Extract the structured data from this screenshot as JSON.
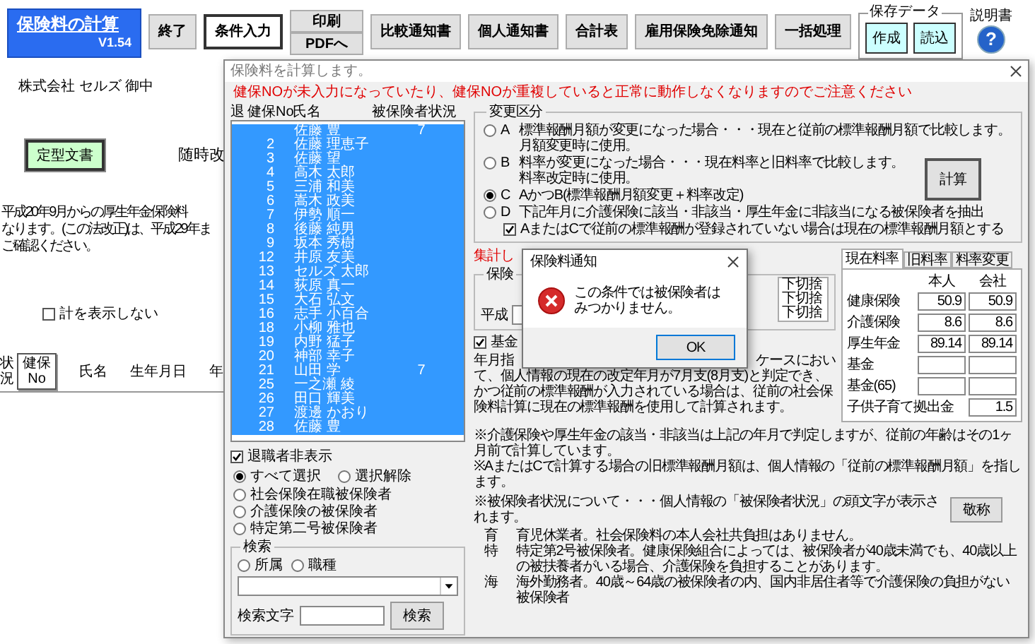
{
  "app_title": {
    "name": "保険料の計算",
    "version": "V1.54"
  },
  "toolbar": [
    {
      "kind": "button",
      "label": "終了",
      "selected": false
    },
    {
      "kind": "button",
      "label": "条件入力",
      "selected": true
    },
    {
      "kind": "stack",
      "labels": [
        "印刷",
        "PDFへ"
      ],
      "selected": false
    },
    {
      "kind": "button",
      "label": "比較通知書",
      "selected": false
    },
    {
      "kind": "button",
      "label": "個人通知書",
      "selected": false
    },
    {
      "kind": "button",
      "label": "合計表",
      "selected": false
    },
    {
      "kind": "button",
      "label": "雇用保険免除通知",
      "selected": false
    },
    {
      "kind": "button",
      "label": "一括処理",
      "selected": false
    }
  ],
  "save_data": {
    "title": "保存データ",
    "buttons": [
      "作成",
      "読込"
    ]
  },
  "help": {
    "label": "説明書",
    "icon": "?"
  },
  "sheet": {
    "company": "株式会社 セルズ 御中",
    "template_button": "定型文書",
    "heading": "随時改",
    "notice": [
      "平成20年9月からの厚生年金保険料",
      "なります。(この法改正)は、平成29年ま",
      "ご確認ください。"
    ],
    "hide_total": {
      "label": "計を表示しない",
      "checked": false
    },
    "columns": [
      {
        "kind": "vertical",
        "label": "状況"
      },
      {
        "kind": "button",
        "label": "健保No"
      },
      {
        "kind": "text",
        "label": "氏名"
      },
      {
        "kind": "text",
        "label": "生年月日"
      },
      {
        "kind": "text",
        "label": "年"
      }
    ]
  },
  "dialog": {
    "title": "保険料を計算します。",
    "warning": "健保NOが未入力になっていたり、健保NOが重複していると正常に動作しなくなりますのでご注意ください",
    "list_headers": [
      "退",
      "健保No",
      "氏名",
      "被保険者状況"
    ],
    "rows": [
      {
        "name": "佐藤 豊",
        "status": "7",
        "selected": true
      },
      {
        "no": "2",
        "name": "佐藤 理恵子",
        "selected": true
      },
      {
        "no": "3",
        "name": "佐藤 望",
        "selected": true
      },
      {
        "no": "4",
        "name": "高木 太郎",
        "selected": true
      },
      {
        "no": "5",
        "name": "三浦 和美",
        "selected": true
      },
      {
        "no": "6",
        "name": "嵩木 政美",
        "selected": true
      },
      {
        "no": "7",
        "name": "伊勢 順一",
        "selected": true
      },
      {
        "no": "8",
        "name": "後藤 純男",
        "selected": true
      },
      {
        "no": "9",
        "name": "坂本 秀樹",
        "selected": true
      },
      {
        "no": "12",
        "name": "井原 友美",
        "selected": true
      },
      {
        "no": "13",
        "name": "セルズ 太郎",
        "selected": true
      },
      {
        "no": "14",
        "name": "荻原 真一",
        "selected": true
      },
      {
        "no": "15",
        "name": "大石 弘文",
        "selected": true
      },
      {
        "no": "16",
        "name": "志手 小百合",
        "selected": true
      },
      {
        "no": "18",
        "name": "小柳 雅也",
        "selected": true
      },
      {
        "no": "19",
        "name": "内野 猛子",
        "selected": true
      },
      {
        "no": "20",
        "name": "神部 幸子",
        "selected": true
      },
      {
        "no": "21",
        "name": "山田 学",
        "status": "7",
        "selected": true
      },
      {
        "no": "25",
        "name": "一之瀬 綾",
        "selected": true
      },
      {
        "no": "26",
        "name": "田口 輝美",
        "selected": true
      },
      {
        "no": "27",
        "name": "渡邊 かおり",
        "selected": true
      },
      {
        "no": "28",
        "name": "佐藤 豊",
        "selected": true
      }
    ],
    "hide_retired": {
      "label": "退職者非表示",
      "checked": true
    },
    "select_all": [
      {
        "label": "すべて選択",
        "selected": true
      },
      {
        "label": "選択解除",
        "selected": false
      }
    ],
    "filters": [
      {
        "label": "社会保険在職被保険者",
        "selected": false
      },
      {
        "label": "介護保険の被保険者",
        "selected": false
      },
      {
        "label": "特定第二号被保険者",
        "selected": false
      }
    ],
    "search": {
      "title": "検索",
      "options": [
        {
          "label": "所属",
          "selected": false
        },
        {
          "label": "職種",
          "selected": false
        }
      ],
      "text_label": "検索文字",
      "button": "検索"
    },
    "change": {
      "title": "変更区分",
      "options": [
        {
          "letter": "A",
          "label": "標準報酬月額が変更になった場合・・・現在と従前の標準報酬月額で比較します。月額変更時に使用。",
          "selected": false
        },
        {
          "letter": "B",
          "label": "料率が変更になった場合・・・現在料率と旧料率で比較します。料率改定時に使用。",
          "selected": false
        },
        {
          "letter": "C",
          "label": "AかつB(標準報酬月額変更＋料率改定)",
          "selected": true
        },
        {
          "letter": "D",
          "label": "下記年月に介護保険に該当・非該当・厚生年金に非該当になる被保険者を抽出",
          "selected": false
        }
      ],
      "sub_check": {
        "label": "AまたはCで従前の標準報酬が登録されていない場合は現在の標準報酬月額とする",
        "checked": true
      },
      "calc_button": "計算"
    },
    "summary": {
      "red_label": "集計し",
      "group_title": "保険",
      "era": "平成",
      "rounding": [
        "下切捨",
        "下切捨",
        "下切捨"
      ],
      "fund": {
        "label": "基金",
        "checked": true
      },
      "para_start": "年月指",
      "para_end": "ケースにおい",
      "para": "て、個人情報の現在の改定年月が7月支(8月支)と判定でき、かつ従前の標準報酬が入力されている場合は、従前の社会保険料計算に現在の標準報酬を使用して計算されます。"
    },
    "rates": {
      "tabs": [
        {
          "label": "現在料率",
          "selected": true
        },
        {
          "label": "旧料率",
          "selected": false
        },
        {
          "label": "料率変更",
          "selected": false
        }
      ],
      "headers": [
        "本人",
        "会社"
      ],
      "rows": [
        {
          "label": "健康保険",
          "person": "50.9",
          "company": "50.9"
        },
        {
          "label": "介護保険",
          "person": "8.6",
          "company": "8.6"
        },
        {
          "label": "厚生年金",
          "person": "89.14",
          "company": "89.14"
        },
        {
          "label": "基金"
        },
        {
          "label": "基金(65)"
        }
      ],
      "child": {
        "label": "子供子育て拠出金",
        "value": "1.5"
      }
    },
    "notes": [
      "※介護保険や厚生年金の該当・非該当は上記の年月で判定しますが、従前の年齢はその1ヶ月前で計算しています。",
      "※AまたはCで計算する場合の旧標準報酬月額は、個人情報の「従前の標準報酬月額」を指します。"
    ],
    "status_note": "※被保険者状況について・・・個人情報の「被保険者状況」の頭文字が表示されます。",
    "honorific_button": "敬称",
    "legend": [
      {
        "mark": "育",
        "text": "育児休業者。社会保険料の本人会社共負担はありません。"
      },
      {
        "mark": "特",
        "text": "特定第2号被保険者。健康保険組合によっては、被保険者が40歳未満でも、40歳以上の被扶養者がいる場合、介護保険を負担することがあります。"
      },
      {
        "mark": "海",
        "text": "海外勤務者。40歳～64歳の被保険者の内、国内非居住者等で介護保険の負担がない被保険者"
      }
    ]
  },
  "message_box": {
    "title": "保険料通知",
    "message": "この条件では被保険者はみつかりません。",
    "button": "OK"
  }
}
